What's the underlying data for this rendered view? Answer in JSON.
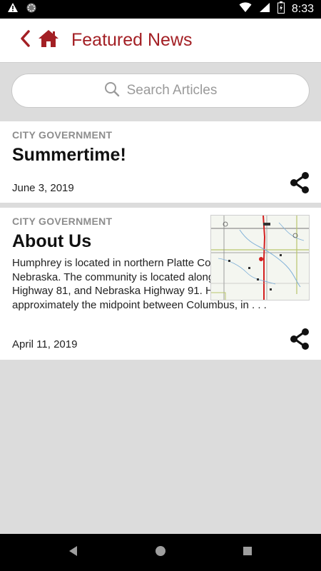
{
  "status_bar": {
    "time": "8:33"
  },
  "header": {
    "title": "Featured News"
  },
  "search": {
    "placeholder": "Search Articles"
  },
  "articles": [
    {
      "category": "CITY GOVERNMENT",
      "title": "Summertime!",
      "excerpt": "",
      "date": "June 3, 2019"
    },
    {
      "category": "CITY GOVERNMENT",
      "title": "About Us",
      "excerpt": "Humphrey is located in northern Platte County, Nebraska. The community is located along US Highway 81, and Nebraska Highway 91. Humphrey is approximately the midpoint between Columbus, in . . .",
      "date": "April 11, 2019"
    }
  ],
  "colors": {
    "accent": "#a31f24",
    "background": "#dcdcdc",
    "card": "#ffffff"
  },
  "icons": {
    "back": "chevron-left-icon",
    "home": "home-icon",
    "search": "search-icon",
    "share": "share-icon",
    "nav_back": "triangle-back-icon",
    "nav_home": "circle-home-icon",
    "nav_recents": "square-recents-icon"
  }
}
